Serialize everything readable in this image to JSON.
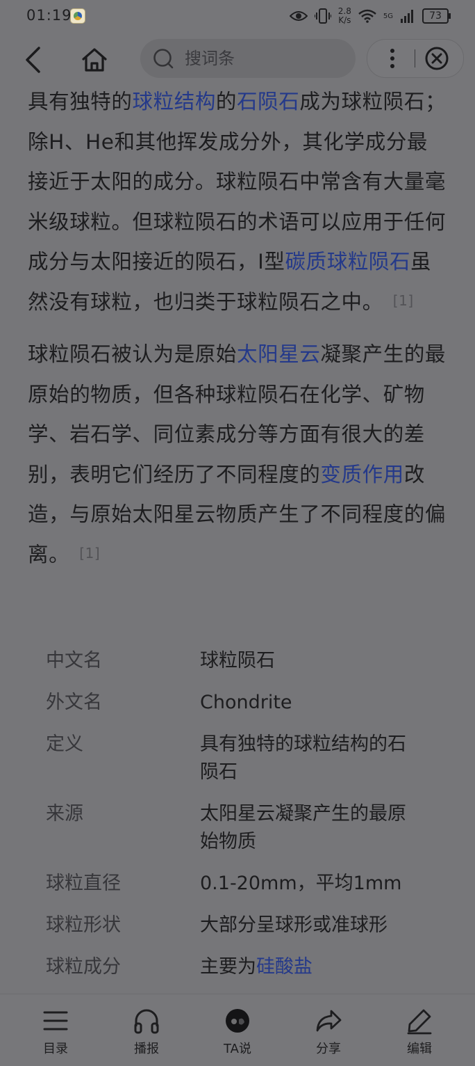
{
  "status_bar": {
    "time": "01:19",
    "net_speed_value": "2.8",
    "net_speed_unit": "K/s",
    "signal_label": "5G",
    "battery": "73"
  },
  "nav": {
    "search_placeholder": "搜词条"
  },
  "article": {
    "p1": {
      "t1": "具有独特的",
      "l1": "球粒结构",
      "t2": "的",
      "l2": "石陨石",
      "t3": "成为球粒陨石；除H、He和其他挥发成分外，其化学成分最接近于太阳的成分。球粒陨石中常含有大量毫米级球粒。但球粒陨石的术语可以应用于任何成分与太阳接近的陨石，I型",
      "l3": "碳质球粒陨石",
      "t4": "虽然没有球粒，也归类于球粒陨石之中。",
      "ref": "[1]"
    },
    "p2": {
      "t1": "球粒陨石被认为是原始",
      "l1": "太阳星云",
      "t2": "凝聚产生的最原始的物质，但各种球粒陨石在化学、矿物学、岩石学、同位素成分等方面有很大的差别，表明它们经历了不同程度的",
      "l2": "变质作用",
      "t3": "改造，与原始太阳星云物质产生了不同程度的偏离。",
      "ref": "[1]"
    }
  },
  "infobox": [
    {
      "label": "中文名",
      "value": "球粒陨石"
    },
    {
      "label": "外文名",
      "value": "Chondrite"
    },
    {
      "label": "定义",
      "value": "具有独特的球粒结构的石陨石"
    },
    {
      "label": "来源",
      "value": "太阳星云凝聚产生的最原始物质"
    },
    {
      "label": "球粒直径",
      "value": "0.1-20mm，平均1mm"
    },
    {
      "label": "球粒形状",
      "value": "大部分呈球形或准球形"
    },
    {
      "label": "球粒成分",
      "value_prefix": "主要为",
      "value_link": "硅酸盐"
    }
  ],
  "tabbar": {
    "toc": "目录",
    "listen": "播报",
    "ta": "TA说",
    "share": "分享",
    "edit": "编辑"
  },
  "colors": {
    "link": "#24398a",
    "background": "#767679"
  }
}
